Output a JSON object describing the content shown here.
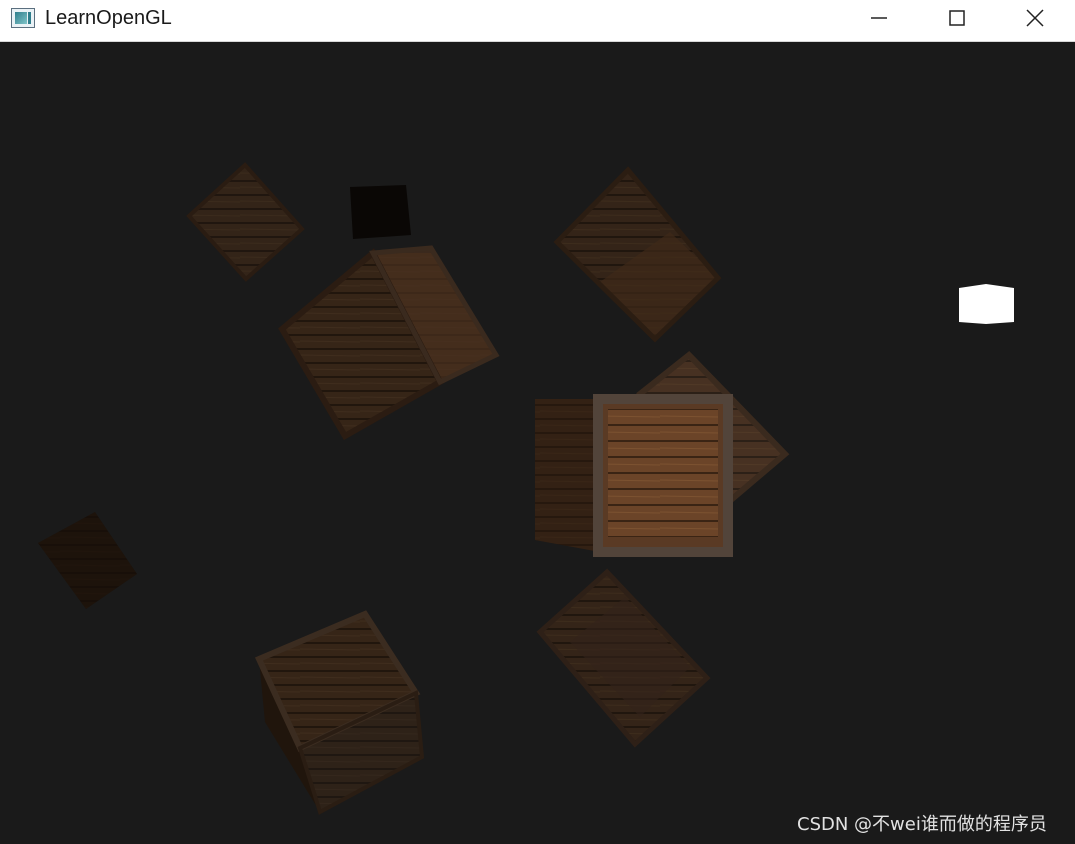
{
  "window": {
    "title": "LearnOpenGL",
    "icon": "opengl-app-icon",
    "controls": [
      {
        "name": "minimize",
        "icon": "minimize-icon"
      },
      {
        "name": "maximize",
        "icon": "maximize-icon"
      },
      {
        "name": "close",
        "icon": "close-icon"
      }
    ]
  },
  "viewport": {
    "background": "#1a1a1a",
    "light_source_color": "#ffffff",
    "crate_color": "#3a2516"
  },
  "watermark": "CSDN @不wei谁而做的程序员"
}
